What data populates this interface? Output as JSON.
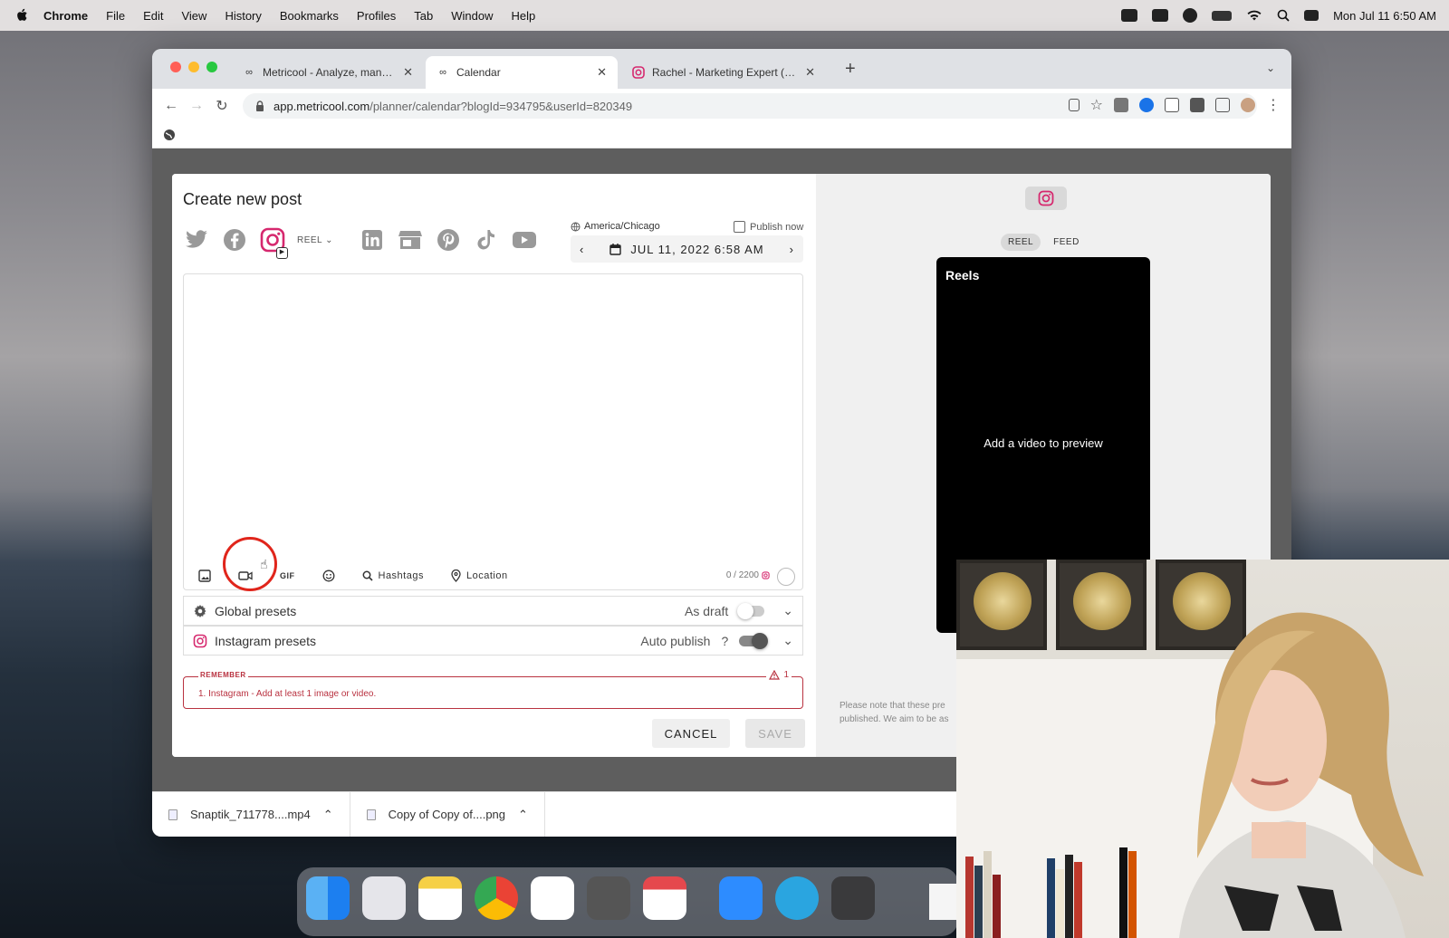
{
  "menubar": {
    "app": "Chrome",
    "items": [
      "File",
      "Edit",
      "View",
      "History",
      "Bookmarks",
      "Profiles",
      "Tab",
      "Window",
      "Help"
    ],
    "clock": "Mon Jul 11  6:50 AM"
  },
  "browser": {
    "tabs": [
      {
        "label": "Metricool - Analyze, manage a",
        "active": false
      },
      {
        "label": "Calendar",
        "active": true
      },
      {
        "label": "Rachel - Marketing Expert (@t",
        "active": false
      }
    ],
    "new_tab": "+",
    "url_host": "app.metricool.com",
    "url_path": "/planner/calendar?blogId=934795&userId=820349"
  },
  "modal": {
    "title": "Create new post",
    "networks": [
      "twitter",
      "facebook",
      "instagram",
      "linkedin",
      "google-business",
      "pinterest",
      "tiktok",
      "youtube"
    ],
    "reel_label": "REEL",
    "timezone": "America/Chicago",
    "publish_now": "Publish now",
    "datetime": "JUL 11, 2022 6:58 AM",
    "tools": {
      "gif": "GIF",
      "hashtags": "Hashtags",
      "location": "Location"
    },
    "char_count": "0 / 2200",
    "global_presets": {
      "label": "Global presets",
      "option": "As draft",
      "enabled": false
    },
    "instagram_presets": {
      "label": "Instagram presets",
      "option": "Auto publish",
      "help": "?",
      "enabled": true
    },
    "remember": {
      "title": "REMEMBER",
      "count": "1",
      "message": "1. Instagram - Add at least 1 image or video."
    },
    "cancel": "CANCEL",
    "save": "SAVE"
  },
  "preview": {
    "tabs": [
      "REEL",
      "FEED"
    ],
    "active_tab": "REEL",
    "phone_title": "Reels",
    "placeholder": "Add a video to preview",
    "note_line1": "Please note that these pre",
    "note_line2": "published. We aim to be as"
  },
  "downloads": [
    {
      "name": "Snaptik_711778....mp4"
    },
    {
      "name": "Copy of Copy of....png"
    }
  ],
  "colors": {
    "instagram": "#d6286e",
    "error": "#b93240",
    "highlight": "#e0251b"
  }
}
